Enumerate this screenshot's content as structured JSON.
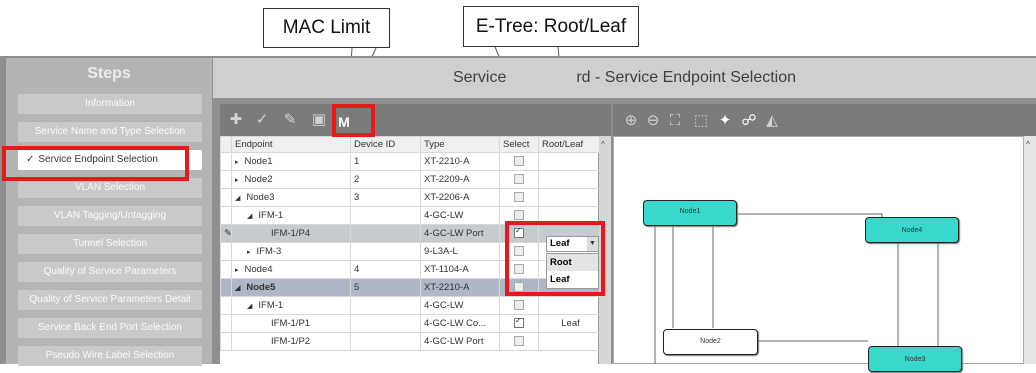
{
  "callouts": {
    "mac_limit": "MAC Limit",
    "etree": "E-Tree: Root/Leaf"
  },
  "steps": {
    "title": "Steps",
    "items": [
      {
        "label": "Information",
        "active": false
      },
      {
        "label": "Service Name and Type Selection",
        "active": false
      },
      {
        "label": "Service Endpoint Selection",
        "active": true,
        "check": "✓"
      },
      {
        "label": "VLAN Selection",
        "active": false
      },
      {
        "label": "VLAN Tagging/Untagging",
        "active": false
      },
      {
        "label": "Tunnel Selection",
        "active": false
      },
      {
        "label": "Quality of Service Parameters",
        "active": false
      },
      {
        "label": "Quality of Service Parameters Detail",
        "active": false
      },
      {
        "label": "Service Back End Port Selection",
        "active": false
      },
      {
        "label": "Pseudo Wire Label Selection",
        "active": false
      }
    ]
  },
  "main": {
    "title_left": "Service",
    "title_right": "rd - Service Endpoint Selection"
  },
  "toolbar": {
    "mac_limit_glyph": "M"
  },
  "table": {
    "columns": [
      "Endpoint",
      "Device ID",
      "Type",
      "Select",
      "Root/Leaf"
    ],
    "rows": [
      {
        "indent": 0,
        "expander": "▸",
        "endpoint": "Node1",
        "device_id": "1",
        "type": "XT-2210-A",
        "select": "off",
        "root_leaf": ""
      },
      {
        "indent": 0,
        "expander": "▸",
        "endpoint": "Node2",
        "device_id": "2",
        "type": "XT-2209-A",
        "select": "off",
        "root_leaf": ""
      },
      {
        "indent": 0,
        "expander": "◢",
        "endpoint": "Node3",
        "device_id": "3",
        "type": "XT-2206-A",
        "select": "off",
        "root_leaf": ""
      },
      {
        "indent": 1,
        "expander": "◢",
        "endpoint": "IFM-1",
        "device_id": "",
        "type": "4-GC-LW",
        "select": "off",
        "root_leaf": ""
      },
      {
        "indent": 2,
        "expander": "",
        "endpoint": "IFM-1/P4",
        "device_id": "",
        "type": "4-GC-LW Port",
        "select": "on",
        "root_leaf": "",
        "highlight": true,
        "edit": "✎"
      },
      {
        "indent": 1,
        "expander": "▸",
        "endpoint": "IFM-3",
        "device_id": "",
        "type": "9-L3A-L",
        "select": "off",
        "root_leaf": ""
      },
      {
        "indent": 0,
        "expander": "▸",
        "endpoint": "Node4",
        "device_id": "4",
        "type": "XT-1104-A",
        "select": "off",
        "root_leaf": ""
      },
      {
        "indent": 0,
        "expander": "◢",
        "endpoint": "Node5",
        "device_id": "5",
        "type": "XT-2210-A",
        "select": "off",
        "root_leaf": "",
        "node5": true
      },
      {
        "indent": 1,
        "expander": "◢",
        "endpoint": "IFM-1",
        "device_id": "",
        "type": "4-GC-LW",
        "select": "off",
        "root_leaf": ""
      },
      {
        "indent": 2,
        "expander": "",
        "endpoint": "IFM-1/P1",
        "device_id": "",
        "type": "4-GC-LW Co...",
        "select": "on",
        "root_leaf": "Leaf"
      },
      {
        "indent": 2,
        "expander": "",
        "endpoint": "IFM-1/P2",
        "device_id": "",
        "type": "4-GC-LW Port",
        "select": "off",
        "root_leaf": ""
      }
    ]
  },
  "dropdown": {
    "selected": "Leaf",
    "options": [
      "Root",
      "Leaf"
    ]
  },
  "diagram": {
    "nodes": [
      {
        "label": "Node1",
        "style": "teal"
      },
      {
        "label": "Node4",
        "style": "teal"
      },
      {
        "label": "Node2",
        "style": "white"
      },
      {
        "label": "Node3",
        "style": "teal"
      }
    ]
  },
  "colors": {
    "highlight_red": "#e8171c",
    "node_teal": "#38d8cd"
  }
}
